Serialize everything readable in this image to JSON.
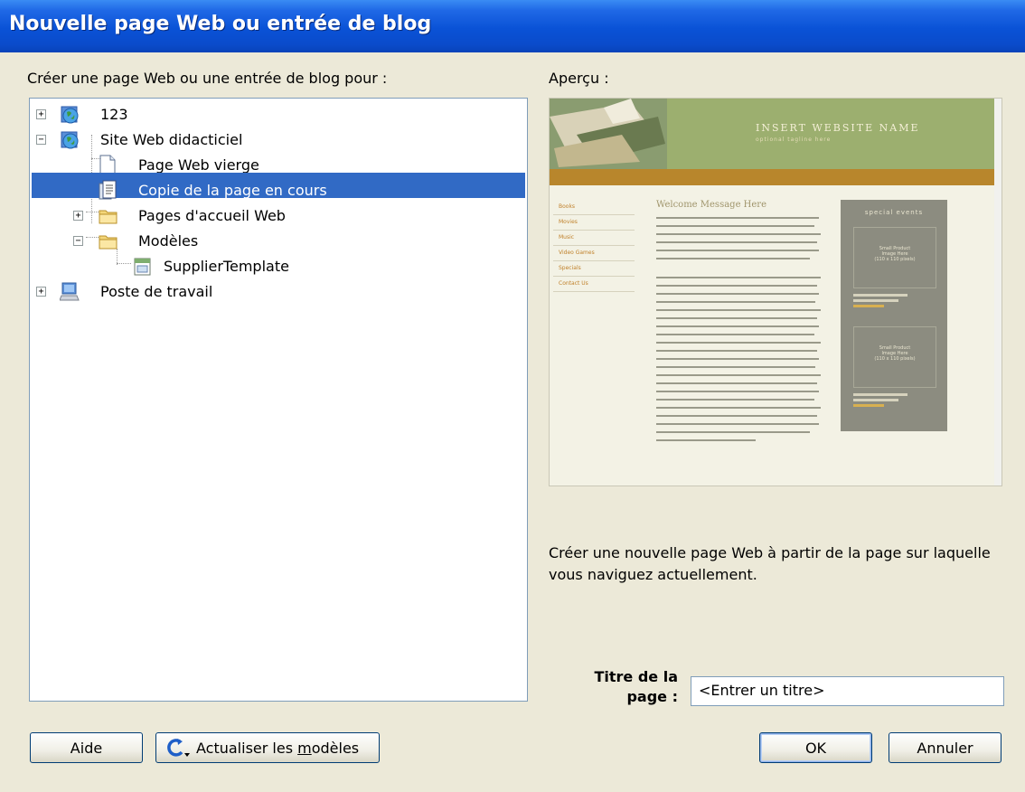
{
  "window": {
    "title": "Nouvelle page Web ou entrée de blog"
  },
  "left": {
    "label": "Créer une page Web ou une entrée de blog pour :"
  },
  "tree": {
    "items": [
      {
        "label": "123",
        "icon": "globe-icon"
      },
      {
        "label": "Site Web didacticiel",
        "icon": "globe-icon"
      },
      {
        "label": "Page Web vierge",
        "icon": "blank-page-icon"
      },
      {
        "label": "Copie de la page en cours",
        "icon": "copy-page-icon"
      },
      {
        "label": "Pages d'accueil Web",
        "icon": "folder-icon"
      },
      {
        "label": "Modèles",
        "icon": "folder-icon"
      },
      {
        "label": "SupplierTemplate",
        "icon": "template-icon"
      },
      {
        "label": "Poste de travail",
        "icon": "computer-icon"
      }
    ]
  },
  "preview": {
    "label": "Aperçu :",
    "thumb": {
      "site_name": "INSERT WEBSITE NAME",
      "tagline": "optional tagline here",
      "heading": "Welcome Message Here",
      "nav": [
        "Books",
        "Movies",
        "Music",
        "Video Games",
        "Specials",
        "Contact Us"
      ],
      "special_title": "special events",
      "product_line1": "Small Product",
      "product_line2": "Image Here",
      "product_line3": "(110 x 110 pixels)"
    },
    "description": "Créer une nouvelle page Web à partir de la page sur laquelle vous naviguez actuellement."
  },
  "form": {
    "title_label_line1": "Titre de la",
    "title_label_line2": "page :",
    "title_value": "<Entrer un titre>"
  },
  "buttons": {
    "help": "Aide",
    "refresh_prefix": "Actualiser les ",
    "refresh_mnemonic": "m",
    "refresh_suffix": "odèles",
    "ok": "OK",
    "cancel": "Annuler"
  },
  "colors": {
    "selection": "#316ac5",
    "titlebar": "#0a52d6",
    "dialog_bg": "#ece9d8"
  }
}
